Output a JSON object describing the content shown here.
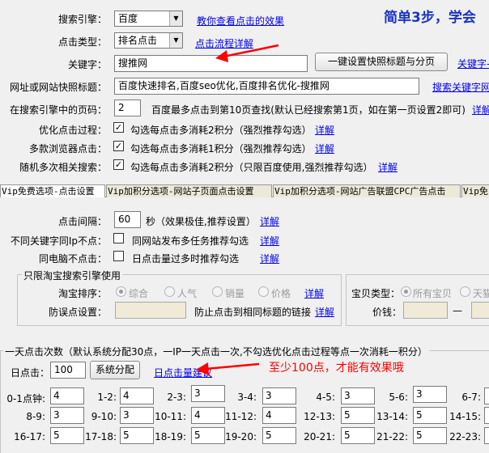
{
  "title_banner": "简单3步，学会",
  "search_engine": {
    "label": "搜索引擎：",
    "value": "百度",
    "help_link": "教你查看点击的效果"
  },
  "click_type": {
    "label": "点击类型：",
    "value": "排名点击",
    "help_link": "点击流程详解"
  },
  "keyword": {
    "label": "关键字：",
    "value": "搜推网",
    "button": "一键设置快照标题与分页",
    "side_link": "关键字-"
  },
  "snapshot_title": {
    "label": "网址或网站快照标题：",
    "value": "百度快速排名,百度seo优化,百度排名优化-搜推网",
    "side_link": "搜索关键字网"
  },
  "page_num": {
    "label": "在搜索引擎中的页码：",
    "value": "2",
    "note": "百度最多点击到第10页查找(默认已经搜索第1页，如在第一页设置2即可)",
    "side_link": "详解"
  },
  "options": [
    {
      "label": "优化点击过程：",
      "checked": true,
      "text": "勾选每点击多消耗2积分（强烈推荐勾选）",
      "link": "详解"
    },
    {
      "label": "多款浏览器点击：",
      "checked": true,
      "text": "勾选每点击多消耗1积分（强烈推荐勾选）",
      "link": "详解"
    },
    {
      "label": "随机多次相关搜索：",
      "checked": true,
      "text": "勾选每点击多消耗2积分（只限百度使用,强烈推荐勾选）",
      "link": "详解"
    }
  ],
  "tabs": [
    {
      "label": "Vip免费选项-点击设置",
      "active": true
    },
    {
      "label": "Vip加积分选项-网站子页面点击设置",
      "active": false
    },
    {
      "label": "Vip加积分选项-网站广告联盟CPC广告点击",
      "active": false
    },
    {
      "label": "Vip免",
      "active": false
    }
  ],
  "interval": {
    "label": "点击间隔：",
    "value": "60",
    "unit": "秒（效果极佳,推荐设置）",
    "link": "详解"
  },
  "diff_ip": {
    "label": "不同关键字同Ip不点：",
    "checked": false,
    "text": "同网站发布多任务推荐勾选",
    "link": "详解"
  },
  "same_pc": {
    "label": "同电脑不点击：",
    "checked": false,
    "text": "日点击量过多时推荐勾选",
    "link": "详解"
  },
  "taobao": {
    "legend": "只限淘宝搜索引擎使用",
    "sort_label": "淘宝排序：",
    "sort_options": [
      "综合",
      "人气",
      "销量",
      "价格"
    ],
    "sort_link": "详解",
    "misclick_label": "防误点设置：",
    "misclick_text": "防止点击到相同标题的链接",
    "misclick_link": "详解",
    "type_label": "宝贝类型：",
    "type_options": [
      "所有宝贝",
      "天猫"
    ],
    "price_label": "价钱：",
    "price_sep": "—"
  },
  "daily": {
    "legend": "一天点击次数（默认系统分配30点，一IP一天点击一次,不勾选优化点击过程等点一次消耗一积分）",
    "label": "日点击：",
    "value": "100",
    "button": "系统分配",
    "link": "日点击量建议",
    "annotation": "至少100点，才能有效果哦"
  },
  "hours": [
    {
      "label": "0-1点钟:",
      "value": "4"
    },
    {
      "label": "1-2:",
      "value": "4"
    },
    {
      "label": "2-3:",
      "value": "3"
    },
    {
      "label": "3-4:",
      "value": "3"
    },
    {
      "label": "4-5:",
      "value": "3"
    },
    {
      "label": "5-6:",
      "value": "3"
    },
    {
      "label": "6-7:",
      "value": ""
    },
    {
      "label": "8-9:",
      "value": "3"
    },
    {
      "label": "9-10:",
      "value": "3"
    },
    {
      "label": "10-11:",
      "value": "4"
    },
    {
      "label": "11-12:",
      "value": "4"
    },
    {
      "label": "12-13:",
      "value": "5"
    },
    {
      "label": "13-14:",
      "value": "5"
    },
    {
      "label": "14-15:",
      "value": ""
    },
    {
      "label": "16-17:",
      "value": "5"
    },
    {
      "label": "17-18:",
      "value": "5"
    },
    {
      "label": "18-19:",
      "value": "5"
    },
    {
      "label": "19-20:",
      "value": "5"
    },
    {
      "label": "20-21:",
      "value": "5"
    },
    {
      "label": "21-22:",
      "value": "5"
    },
    {
      "label": "22-23:",
      "value": ""
    }
  ],
  "colors": {
    "link": "#0000ee",
    "banner": "#1a33c4",
    "annotation": "#ff0000",
    "arrow": "#ff0000"
  }
}
